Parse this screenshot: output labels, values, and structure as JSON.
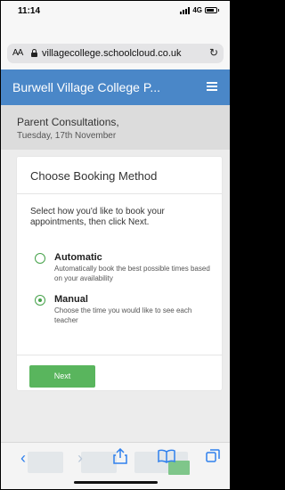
{
  "status_bar": {
    "time": "11:14",
    "network": "4G"
  },
  "browser": {
    "text_size_label": "AA",
    "url": "villagecollege.schoolcloud.co.uk",
    "reload_icon": "reload-icon"
  },
  "header": {
    "title": "Burwell Village College P...",
    "menu_icon": "hamburger-menu-icon",
    "color": "#4a87c8"
  },
  "subheader": {
    "title": "Parent Consultations,",
    "date": "Tuesday, 17th November"
  },
  "booking": {
    "title": "Choose Booking Method",
    "instructions": "Select how you'd like to book your appointments, then click Next.",
    "options": [
      {
        "label": "Automatic",
        "description": "Automatically book the best possible times based on your availability",
        "selected": false
      },
      {
        "label": "Manual",
        "description": "Choose the time you would like to see each teacher",
        "selected": true
      }
    ],
    "next_label": "Next",
    "accent_color": "#46a24a"
  },
  "toolbar": {
    "icons": [
      "back-icon",
      "forward-icon",
      "share-icon",
      "bookmarks-icon",
      "tabs-icon"
    ]
  }
}
